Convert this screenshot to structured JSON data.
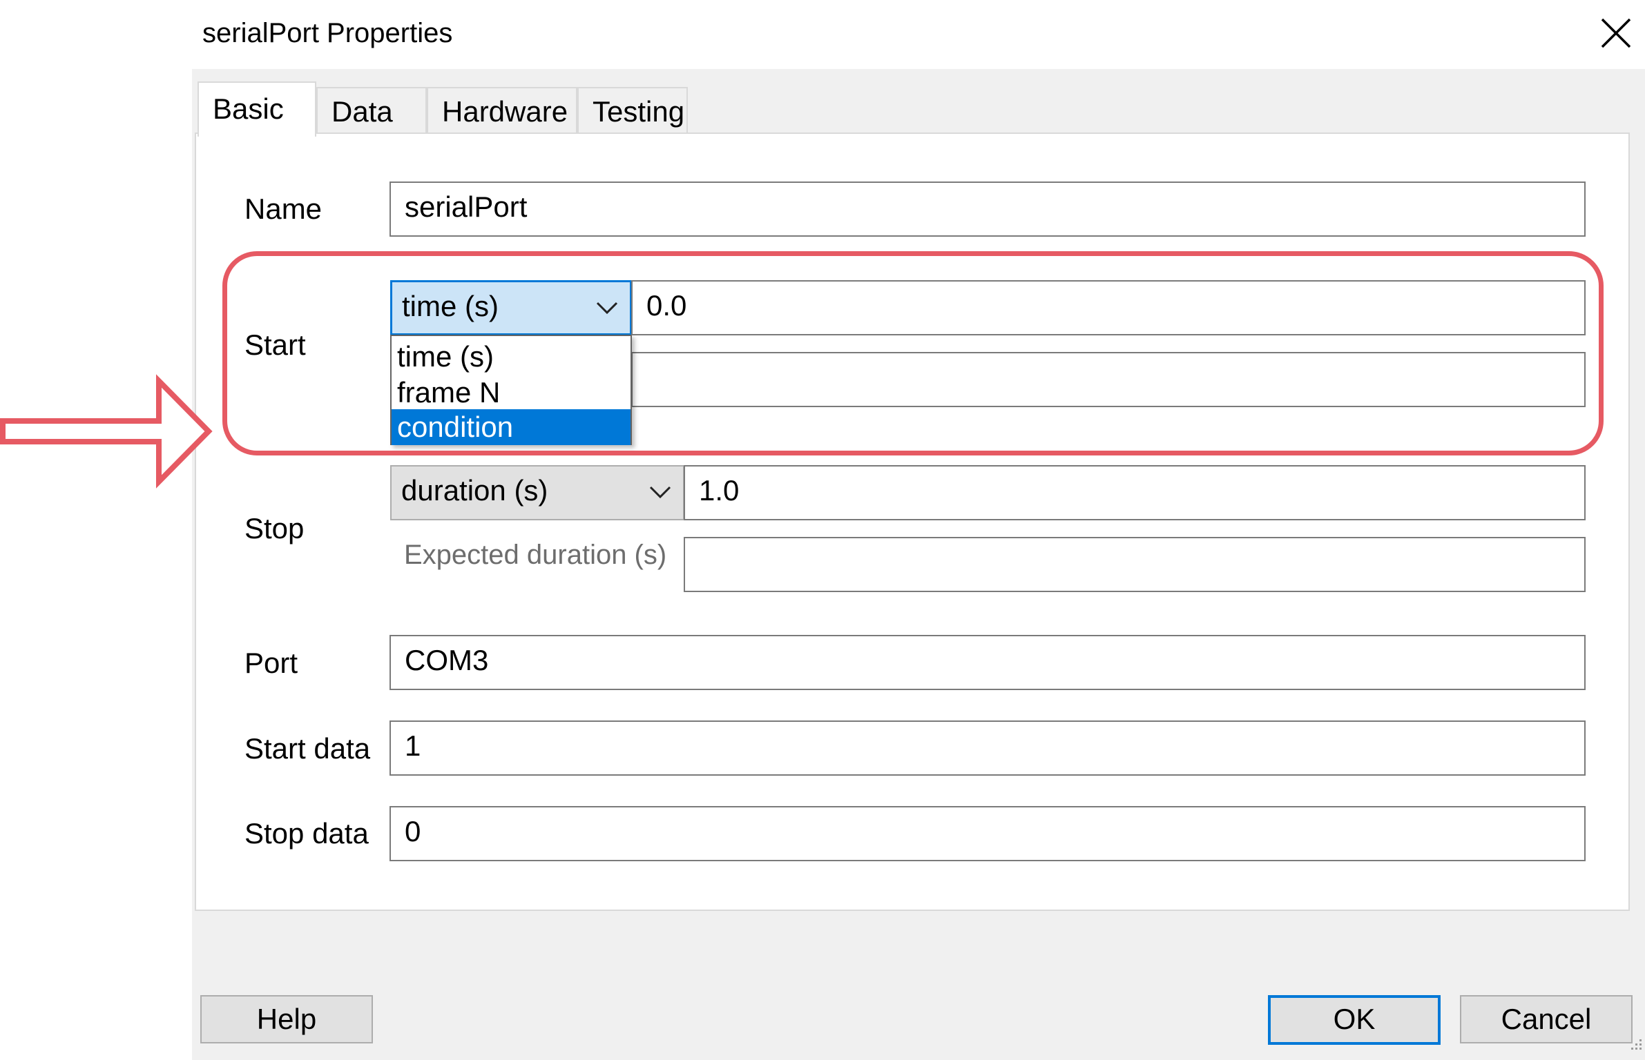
{
  "window": {
    "title": "serialPort Properties"
  },
  "tabs": [
    {
      "label": "Basic",
      "active": true
    },
    {
      "label": "Data",
      "active": false
    },
    {
      "label": "Hardware",
      "active": false
    },
    {
      "label": "Testing",
      "active": false
    }
  ],
  "form": {
    "name": {
      "label": "Name",
      "value": "serialPort"
    },
    "start": {
      "label": "Start",
      "type_selected": "time (s)",
      "value": "0.0",
      "expected_value": "",
      "dropdown_open": true,
      "dropdown_options": [
        "time (s)",
        "frame N",
        "condition"
      ],
      "dropdown_highlighted": "condition"
    },
    "stop": {
      "label": "Stop",
      "type_selected": "duration (s)",
      "value": "1.0",
      "expected_label": "Expected duration (s)",
      "expected_value": ""
    },
    "port": {
      "label": "Port",
      "value": "COM3"
    },
    "start_data": {
      "label": "Start data",
      "value": "1"
    },
    "stop_data": {
      "label": "Stop data",
      "value": "0"
    }
  },
  "buttons": {
    "help": "Help",
    "ok": "OK",
    "cancel": "Cancel"
  },
  "annotation": {
    "highlight_color": "#e65a63"
  },
  "colors": {
    "accent": "#0078d7",
    "dialog_bg": "#f0f0f0"
  },
  "icons": {
    "close": "close-icon",
    "dropdown": "chevron-down-icon",
    "callout_arrow": "arrow-right-icon"
  }
}
